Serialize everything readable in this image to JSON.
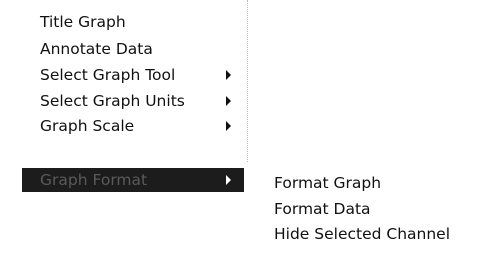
{
  "context_menu": {
    "items": [
      {
        "label": "Title Graph",
        "has_submenu": false,
        "selected": false
      },
      {
        "label": "Annotate Data",
        "has_submenu": false,
        "selected": false
      },
      {
        "label": "Select Graph Tool",
        "has_submenu": true,
        "selected": false
      },
      {
        "label": "Select Graph Units",
        "has_submenu": true,
        "selected": false
      },
      {
        "label": "Graph Scale",
        "has_submenu": true,
        "selected": false
      },
      {
        "label": "Graph Format",
        "has_submenu": true,
        "selected": true
      }
    ]
  },
  "submenu": {
    "parent": "Graph Format",
    "items": [
      {
        "label": "Format Graph"
      },
      {
        "label": "Format Data"
      },
      {
        "label": "Hide Selected Channel"
      }
    ]
  },
  "colors": {
    "selected_background": "#1c1c1c",
    "selected_text": "#5a5a5a",
    "text": "#111111"
  },
  "icons": {
    "submenu_indicator": "chevron-right-icon"
  }
}
